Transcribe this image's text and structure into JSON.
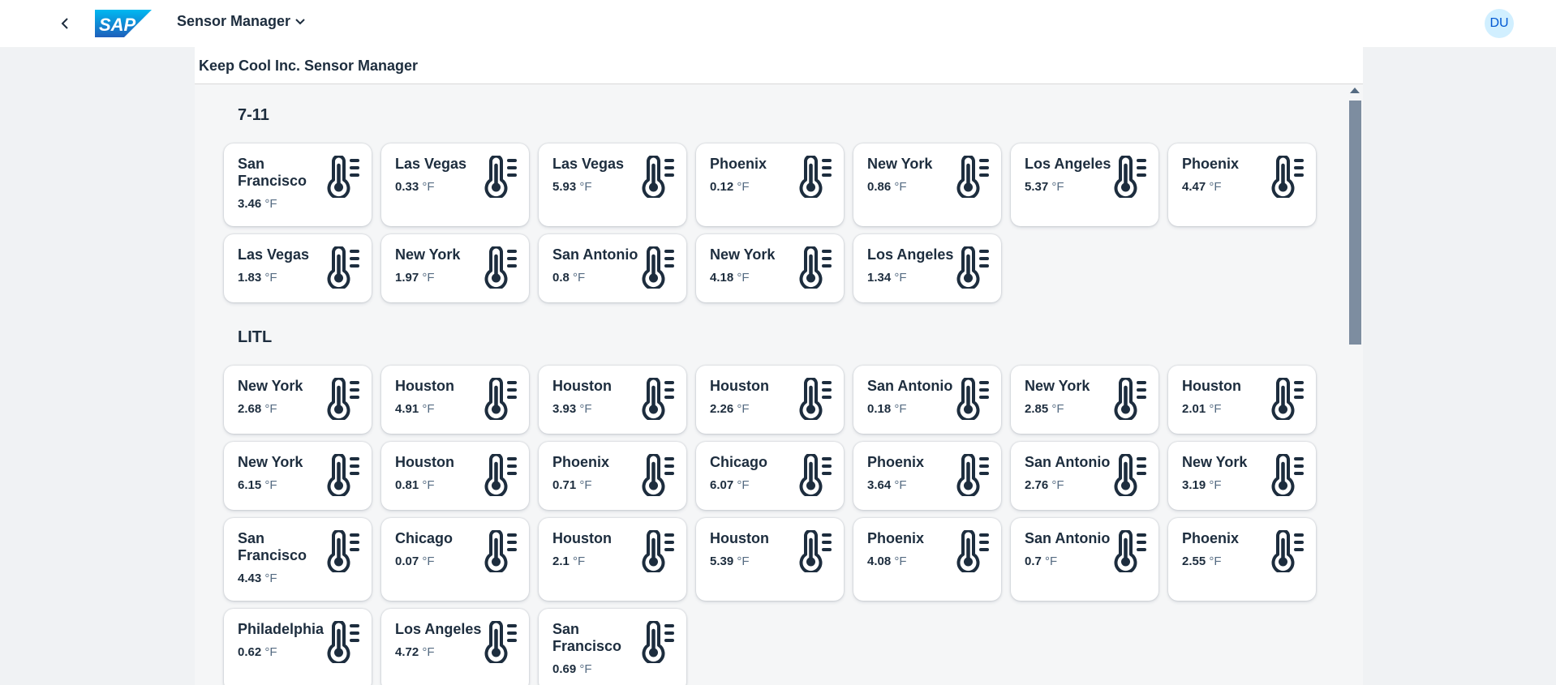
{
  "shell": {
    "logo_text": "SAP",
    "app_title": "Sensor Manager",
    "avatar_initials": "DU"
  },
  "page": {
    "title": "Keep Cool Inc. Sensor Manager"
  },
  "groups": [
    {
      "title": "7-11",
      "rows": [
        [
          {
            "city": "San Francisco",
            "value": "3.46",
            "unit": "°F"
          },
          {
            "city": "Las Vegas",
            "value": "0.33",
            "unit": "°F"
          },
          {
            "city": "Las Vegas",
            "value": "5.93",
            "unit": "°F"
          },
          {
            "city": "Phoenix",
            "value": "0.12",
            "unit": "°F"
          },
          {
            "city": "New York",
            "value": "0.86",
            "unit": "°F"
          },
          {
            "city": "Los Angeles",
            "value": "5.37",
            "unit": "°F"
          },
          {
            "city": "Phoenix",
            "value": "4.47",
            "unit": "°F"
          }
        ],
        [
          {
            "city": "Las Vegas",
            "value": "1.83",
            "unit": "°F"
          },
          {
            "city": "New York",
            "value": "1.97",
            "unit": "°F"
          },
          {
            "city": "San Antonio",
            "value": "0.8",
            "unit": "°F"
          },
          {
            "city": "New York",
            "value": "4.18",
            "unit": "°F"
          },
          {
            "city": "Los Angeles",
            "value": "1.34",
            "unit": "°F"
          }
        ]
      ]
    },
    {
      "title": "LITL",
      "rows": [
        [
          {
            "city": "New York",
            "value": "2.68",
            "unit": "°F"
          },
          {
            "city": "Houston",
            "value": "4.91",
            "unit": "°F"
          },
          {
            "city": "Houston",
            "value": "3.93",
            "unit": "°F"
          },
          {
            "city": "Houston",
            "value": "2.26",
            "unit": "°F"
          },
          {
            "city": "San Antonio",
            "value": "0.18",
            "unit": "°F"
          },
          {
            "city": "New York",
            "value": "2.85",
            "unit": "°F"
          },
          {
            "city": "Houston",
            "value": "2.01",
            "unit": "°F"
          }
        ],
        [
          {
            "city": "New York",
            "value": "6.15",
            "unit": "°F"
          },
          {
            "city": "Houston",
            "value": "0.81",
            "unit": "°F"
          },
          {
            "city": "Phoenix",
            "value": "0.71",
            "unit": "°F"
          },
          {
            "city": "Chicago",
            "value": "6.07",
            "unit": "°F"
          },
          {
            "city": "Phoenix",
            "value": "3.64",
            "unit": "°F"
          },
          {
            "city": "San Antonio",
            "value": "2.76",
            "unit": "°F"
          },
          {
            "city": "New York",
            "value": "3.19",
            "unit": "°F"
          }
        ],
        [
          {
            "city": "San Francisco",
            "value": "4.43",
            "unit": "°F"
          },
          {
            "city": "Chicago",
            "value": "0.07",
            "unit": "°F"
          },
          {
            "city": "Houston",
            "value": "2.1",
            "unit": "°F"
          },
          {
            "city": "Houston",
            "value": "5.39",
            "unit": "°F"
          },
          {
            "city": "Phoenix",
            "value": "4.08",
            "unit": "°F"
          },
          {
            "city": "San Antonio",
            "value": "0.7",
            "unit": "°F"
          },
          {
            "city": "Phoenix",
            "value": "2.55",
            "unit": "°F"
          }
        ],
        [
          {
            "city": "Philadelphia",
            "value": "0.62",
            "unit": "°F"
          },
          {
            "city": "Los Angeles",
            "value": "4.72",
            "unit": "°F"
          },
          {
            "city": "San Francisco",
            "value": "0.69",
            "unit": "°F"
          }
        ]
      ]
    }
  ],
  "icons": {
    "back": "chevron-left-icon",
    "menu": "chevron-down-icon",
    "tile": "thermometer-icon"
  },
  "colors": {
    "brand_blue": "#0070f2",
    "text": "#1d2d3e",
    "avatar_bg": "#d1efff",
    "avatar_text": "#0057d2"
  }
}
